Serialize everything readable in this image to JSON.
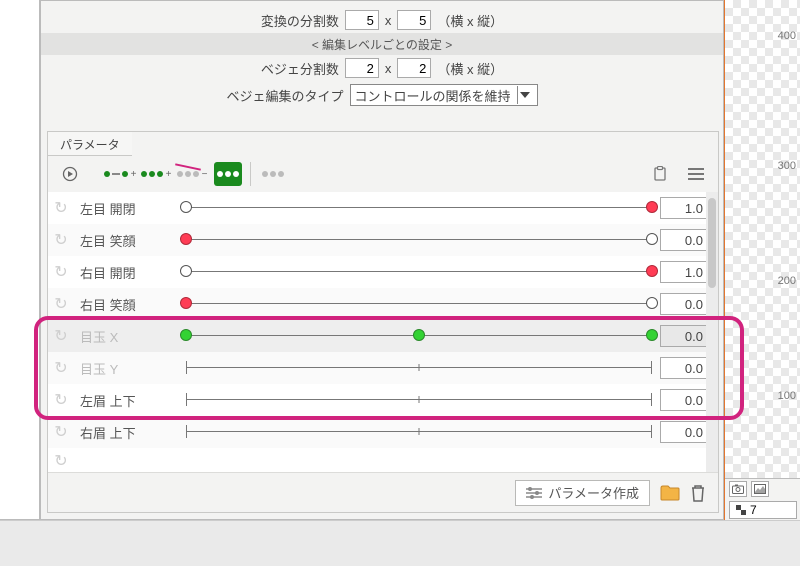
{
  "settings": {
    "divisions_label": "変換の分割数",
    "divisions_w": "5",
    "divisions_h": "5",
    "divisions_suffix": "（横 x 縦）",
    "section_title": "< 編集レベルごとの設定 >",
    "bezier_label": "ベジェ分割数",
    "bezier_w": "2",
    "bezier_h": "2",
    "bezier_suffix": "（横 x 縦）",
    "bezier_type_label": "ベジェ編集のタイプ",
    "bezier_type_value": "コントロールの関係を維持"
  },
  "panel": {
    "tab_label": "パラメータ",
    "footer_create": "パラメータ作成"
  },
  "params": [
    {
      "label": "左目 開閉",
      "value": "1.0",
      "knobPos": [
        0,
        1
      ],
      "knobStyle": [
        "hollow",
        "red"
      ],
      "endCaps": false,
      "dimLabel": false,
      "dimValue": false,
      "ticks": []
    },
    {
      "label": "左目 笑顔",
      "value": "0.0",
      "knobPos": [
        0,
        1
      ],
      "knobStyle": [
        "red",
        "hollow"
      ],
      "endCaps": false,
      "dimLabel": false,
      "dimValue": false,
      "ticks": []
    },
    {
      "label": "右目 開閉",
      "value": "1.0",
      "knobPos": [
        0,
        1
      ],
      "knobStyle": [
        "hollow",
        "red"
      ],
      "endCaps": false,
      "dimLabel": false,
      "dimValue": false,
      "ticks": []
    },
    {
      "label": "右目 笑顔",
      "value": "0.0",
      "knobPos": [
        0,
        1
      ],
      "knobStyle": [
        "red",
        "hollow"
      ],
      "endCaps": false,
      "dimLabel": false,
      "dimValue": false,
      "ticks": []
    },
    {
      "label": "目玉 X",
      "value": "0.0",
      "knobPos": [
        0,
        0.5,
        1
      ],
      "knobStyle": [
        "green",
        "green",
        "green"
      ],
      "endCaps": false,
      "dimLabel": true,
      "dimValue": true,
      "ticks": [],
      "selected": true
    },
    {
      "label": "目玉 Y",
      "value": "0.0",
      "knobPos": [],
      "knobStyle": [],
      "endCaps": true,
      "dimLabel": true,
      "dimValue": false,
      "ticks": [
        0.5
      ]
    },
    {
      "label": "左眉 上下",
      "value": "0.0",
      "knobPos": [],
      "knobStyle": [],
      "endCaps": true,
      "dimLabel": false,
      "dimValue": false,
      "ticks": [
        0.5
      ]
    },
    {
      "label": "右眉 上下",
      "value": "0.0",
      "knobPos": [],
      "knobStyle": [],
      "endCaps": true,
      "dimLabel": false,
      "dimValue": false,
      "ticks": [
        0.5
      ]
    }
  ],
  "ruler": {
    "marks": [
      "400",
      "300",
      "200",
      "100"
    ]
  },
  "right_field": "7"
}
